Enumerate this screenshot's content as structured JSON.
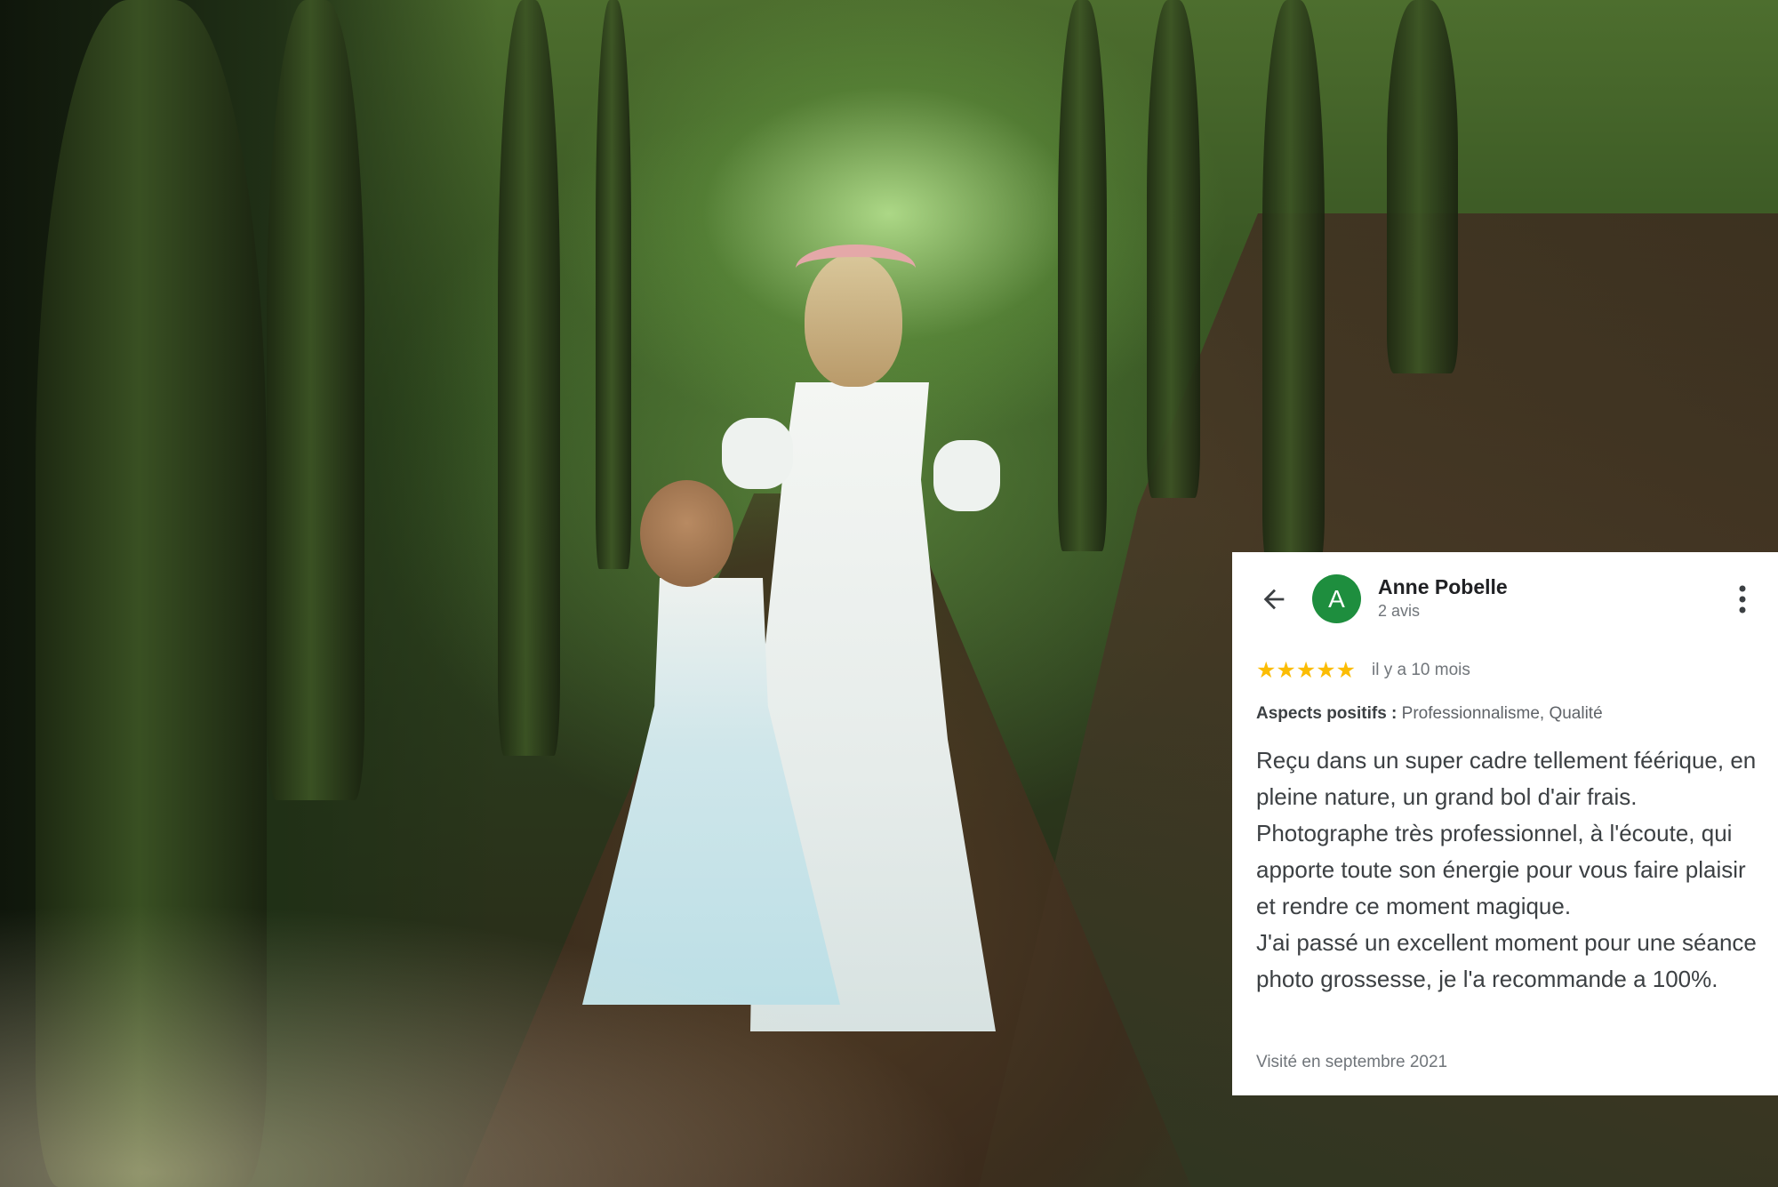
{
  "background": {
    "subject": "forest-maternity-photo"
  },
  "review": {
    "back_icon": "arrow-left-icon",
    "avatar_letter": "A",
    "avatar_color": "#1e8e3e",
    "reviewer_name": "Anne Pobelle",
    "reviewer_count": "2 avis",
    "menu_icon": "more-vert-icon",
    "rating": 5,
    "stars": "★★★★★",
    "star_color": "#fbbc04",
    "date": "il y a 10 mois",
    "aspects_label": "Aspects positifs :",
    "aspects_value": "Professionnalisme, Qualité",
    "body_paragraph_1": "Reçu dans un super cadre tellement féérique, en pleine nature, un grand bol d'air frais. Photographe très professionnel, à l'écoute, qui apporte toute son énergie pour vous faire plaisir et rendre ce moment magique.",
    "body_paragraph_2": "J'ai passé un excellent moment pour une séance photo grossesse, je l'a recommande a 100%.",
    "visited": "Visité en septembre 2021"
  }
}
